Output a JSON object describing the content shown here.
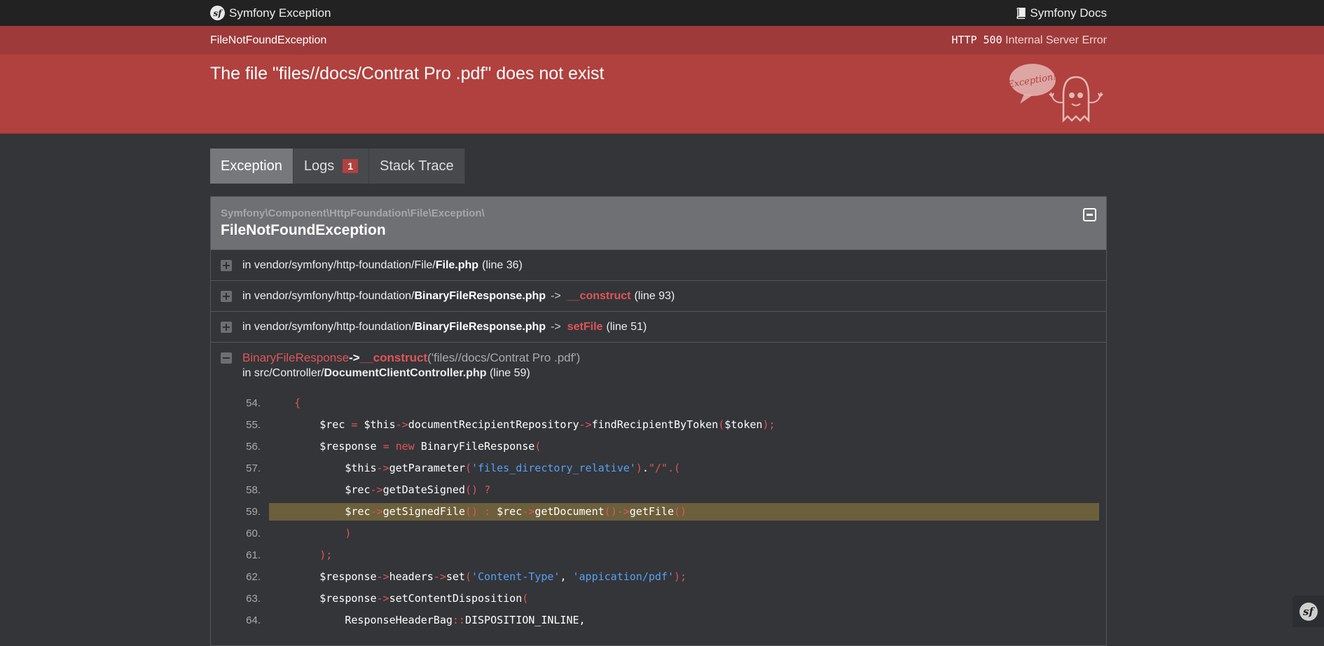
{
  "topbar": {
    "brand": "Symfony Exception",
    "docs_link": "Symfony Docs",
    "logo_text": "sf"
  },
  "status": {
    "exception_short": "FileNotFoundException",
    "http_code": "HTTP 500",
    "http_reason": "Internal Server Error"
  },
  "message": "The file \"files//docs/Contrat Pro .pdf\" does not exist",
  "ghost_bubble": "Exception!",
  "tabs": [
    {
      "label": "Exception",
      "active": true
    },
    {
      "label": "Logs",
      "badge": "1"
    },
    {
      "label": "Stack Trace"
    }
  ],
  "exception": {
    "namespace": "Symfony\\Component\\HttpFoundation\\File\\Exception\\",
    "class": "FileNotFoundException"
  },
  "frames": [
    {
      "prefix": "in ",
      "path": "vendor/symfony/http-foundation/File/",
      "file": "File.php",
      "arrow": "",
      "function": "",
      "line": "(line 36)"
    },
    {
      "prefix": "in ",
      "path": "vendor/symfony/http-foundation/",
      "file": "BinaryFileResponse.php",
      "arrow": "->",
      "function": "__construct",
      "line": "(line 93)"
    },
    {
      "prefix": "in ",
      "path": "vendor/symfony/http-foundation/",
      "file": "BinaryFileResponse.php",
      "arrow": "->",
      "function": "setFile",
      "line": "(line 51)"
    }
  ],
  "open_frame": {
    "class": "BinaryFileResponse",
    "arrow": "->",
    "function": "__construct",
    "args": "('files//docs/Contrat Pro .pdf')",
    "location_prefix": "in ",
    "path": "src/Controller/",
    "file": "DocumentClientController.php",
    "line": "(line 59)"
  },
  "code_lines": [
    {
      "num": "54.",
      "text": "    {"
    },
    {
      "num": "55.",
      "text": "        $rec = $this->documentRecipientRepository->findRecipientByToken($token);"
    },
    {
      "num": "56.",
      "text": "        $response = new BinaryFileResponse("
    },
    {
      "num": "57.",
      "text": "            $this->getParameter('files_directory_relative').\"/\".("
    },
    {
      "num": "58.",
      "text": "            $rec->getDateSigned() ?"
    },
    {
      "num": "59.",
      "text": "            $rec->getSignedFile() : $rec->getDocument()->getFile()",
      "highlight": true
    },
    {
      "num": "60.",
      "text": "            )"
    },
    {
      "num": "61.",
      "text": "        );"
    },
    {
      "num": "62.",
      "text": "        $response->headers->set('Content-Type', 'appication/pdf');"
    },
    {
      "num": "63.",
      "text": "        $response->setContentDisposition("
    },
    {
      "num": "64.",
      "text": "            ResponseHeaderBag::DISPOSITION_INLINE,"
    }
  ],
  "colors": {
    "accent_red": "#b0413e",
    "band_dark_red": "#9e3a3a",
    "highlight": "#6b5f3c",
    "function_red": "#e05556",
    "string_blue": "#57a0f2"
  }
}
